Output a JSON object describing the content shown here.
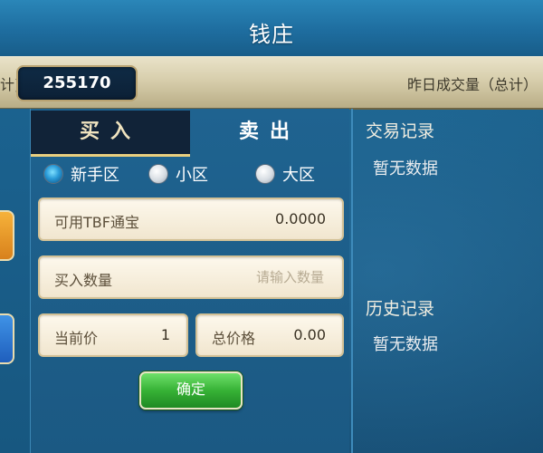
{
  "title": "钱庄",
  "banner": {
    "left_label_fragment": "计)",
    "volume_value": "255170",
    "right_label": "昨日成交量（总计）"
  },
  "tabs": {
    "buy": "买入",
    "sell": "卖出"
  },
  "zones": [
    {
      "label": "新手区",
      "selected": true
    },
    {
      "label": "小区",
      "selected": false
    },
    {
      "label": "大区",
      "selected": false
    }
  ],
  "form": {
    "available_label": "可用TBF通宝",
    "available_value": "0.0000",
    "quantity_label": "买入数量",
    "quantity_placeholder": "请输入数量",
    "price_label": "当前价",
    "price_value": "1",
    "total_label": "总价格",
    "total_value": "0.00",
    "confirm_label": "确定"
  },
  "records": {
    "trade_title": "交易记录",
    "trade_empty": "暂无数据",
    "history_title": "历史记录",
    "history_empty": "暂无数据"
  },
  "colors": {
    "background": "#1f5a84",
    "banner": "#d7ceac",
    "field": "#f6eedb",
    "confirm": "#37b236",
    "tab_active": "#112338"
  }
}
